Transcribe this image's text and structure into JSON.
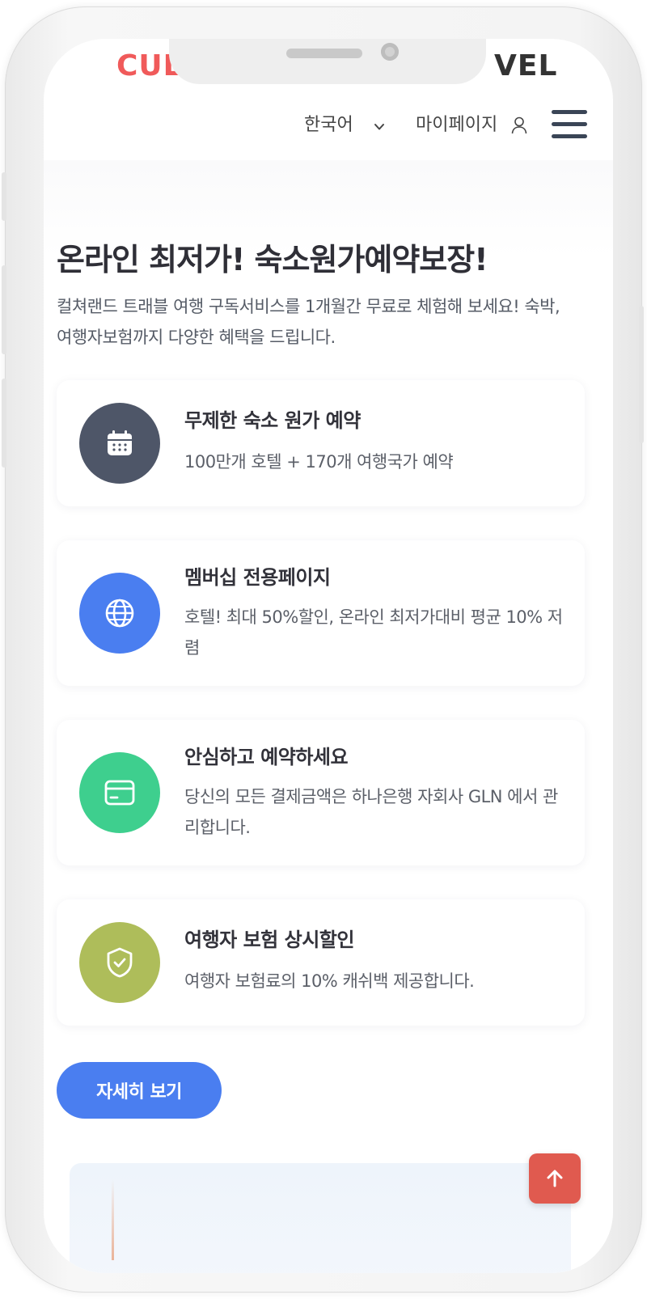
{
  "header": {
    "logo_left": "CUL",
    "logo_right": "VEL",
    "language": "한국어",
    "mypage": "마이페이지"
  },
  "hero": {
    "title": "온라인 최저가! 숙소원가예약보장!",
    "subtitle": "컬쳐랜드 트래블 여행 구독서비스를 1개월간 무료로 체험해 보세요! 숙박, 여행자보험까지 다양한 혜택을 드립니다."
  },
  "features": [
    {
      "title": "무제한 숙소 원가 예약",
      "desc": "100만개 호텔 + 170개 여행국가 예약",
      "icon": "calendar-icon",
      "color": "#4e5668"
    },
    {
      "title": "멤버십 전용페이지",
      "desc": "호텔! 최대 50%할인, 온라인 최저가대비 평균 10% 저렴",
      "icon": "globe-icon",
      "color": "#4a7ef0"
    },
    {
      "title": "안심하고 예약하세요",
      "desc": "당신의 모든 결제금액은 하나은행 자회사 GLN 에서 관리합니다.",
      "icon": "credit-card-icon",
      "color": "#3ecf8e"
    },
    {
      "title": "여행자 보험 상시할인",
      "desc": "여행자 보험료의 10% 캐쉬백 제공합니다.",
      "icon": "shield-check-icon",
      "color": "#aebd5a"
    }
  ],
  "cta": {
    "label": "자세히 보기"
  },
  "scroll_top": {
    "icon": "arrow-up-icon"
  }
}
